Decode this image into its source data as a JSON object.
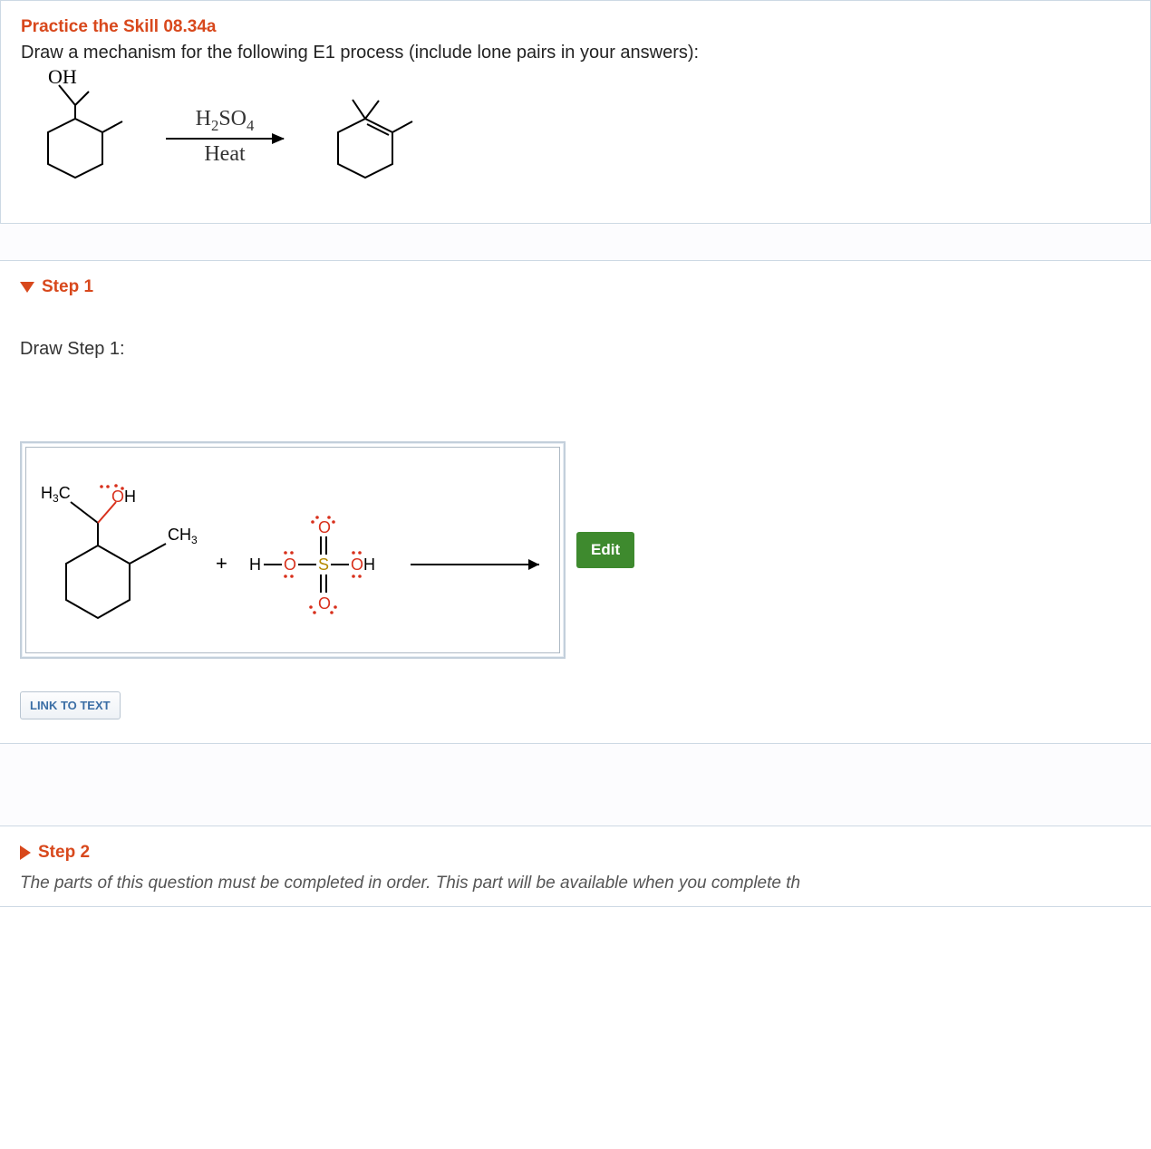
{
  "header": {
    "title": "Practice the Skill 08.34a",
    "prompt": "Draw a mechanism for the following E1 process (include lone pairs in your answers):",
    "reaction": {
      "reactant_label": "OH",
      "reagent_top": "H₂SO₄",
      "reagent_bottom": "Heat"
    }
  },
  "step1": {
    "heading": "Step 1",
    "prompt": "Draw Step 1:",
    "edit_label": "Edit",
    "link_label": "LINK TO TEXT",
    "structure": {
      "left_labels": {
        "h3c": "H₃C",
        "oh": "OH",
        "ch3": "CH₃"
      },
      "plus": "+",
      "acid": "H — O — S — OH with two =O (sulfuric acid, lone pairs on O)"
    }
  },
  "step2": {
    "heading": "Step 2",
    "locked_text": "The parts of this question must be completed in order. This part will be available when you complete th"
  }
}
